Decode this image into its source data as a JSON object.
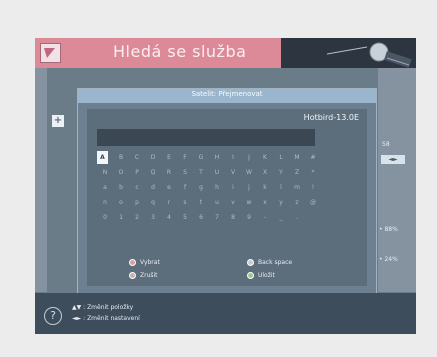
{
  "header": {
    "title": "Hledá se služba"
  },
  "dialog": {
    "title": "Satelit: Přejmenovat",
    "satellite_name": "Hotbird-13.0E",
    "input_value": "",
    "keyboard_rows": [
      [
        "A",
        "B",
        "C",
        "D",
        "E",
        "F",
        "G",
        "H",
        "I",
        "J",
        "K",
        "L",
        "M",
        "#"
      ],
      [
        "N",
        "O",
        "P",
        "Q",
        "R",
        "S",
        "T",
        "U",
        "V",
        "W",
        "X",
        "Y",
        "Z",
        "*"
      ],
      [
        "a",
        "b",
        "c",
        "d",
        "e",
        "f",
        "g",
        "h",
        "i",
        "j",
        "k",
        "l",
        "m",
        "!"
      ],
      [
        "n",
        "o",
        "p",
        "q",
        "r",
        "s",
        "t",
        "u",
        "v",
        "w",
        "x",
        "y",
        "z",
        "@"
      ],
      [
        "0",
        "1",
        "2",
        "3",
        "4",
        "5",
        "6",
        "7",
        "8",
        "9",
        "-",
        "_",
        "."
      ]
    ],
    "legend": {
      "select_label": "Vybrat",
      "back_space_label": "Back space",
      "exit_label": "Zrušit",
      "save_label": "Uložit"
    }
  },
  "right_panel": {
    "value_top": "58",
    "value_mid": "• 88%",
    "value_bottom": "• 24%"
  },
  "footer": {
    "hint_up_down": "▲▼ : Změnit položky",
    "hint_left_right": "◄► : Změnit nastavení"
  },
  "colors": {
    "title_bar": "#dc8a98",
    "select_dot": "#d9a0a0",
    "back_space_dot": "#c8ccd2",
    "exit_dot": "#c8b0b0",
    "save_dot": "#9cc890"
  }
}
